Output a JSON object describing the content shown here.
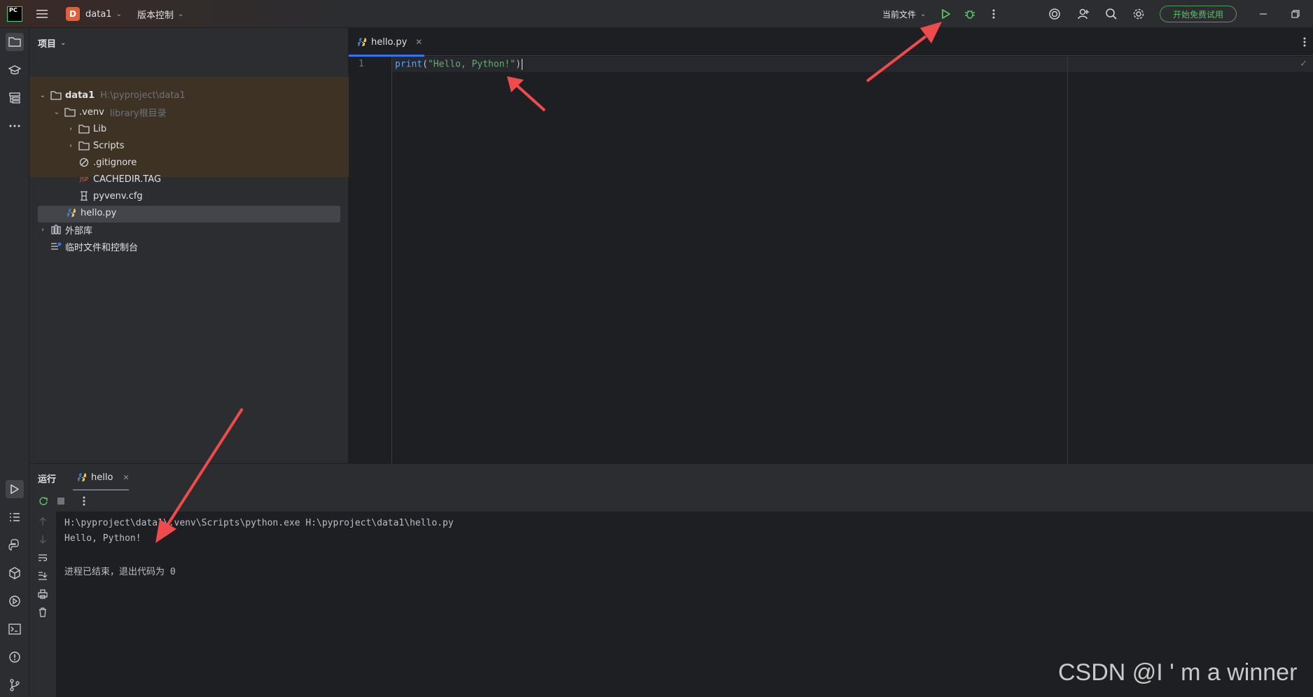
{
  "titlebar": {
    "logo_text": "PC",
    "project_badge": "D",
    "project_name": "data1",
    "vcs_label": "版本控制",
    "run_config": "当前文件",
    "trial_button": "开始免费试用"
  },
  "project_panel": {
    "header": "项目",
    "tree": [
      {
        "name": "data1",
        "hint": "H:\\pyproject\\data1"
      },
      {
        "name": ".venv",
        "hint": "library根目录"
      },
      {
        "name": "Lib"
      },
      {
        "name": "Scripts"
      },
      {
        "name": ".gitignore"
      },
      {
        "name": "CACHEDIR.TAG"
      },
      {
        "name": "pyvenv.cfg"
      },
      {
        "name": "hello.py"
      },
      {
        "name": "外部库"
      },
      {
        "name": "临时文件和控制台"
      }
    ]
  },
  "editor": {
    "tab_label": "hello.py",
    "line_number": "1",
    "code": {
      "fn": "print",
      "open": "(",
      "str": "\"Hello, Python!\"",
      "close": ")"
    }
  },
  "run_panel": {
    "title": "运行",
    "tab_label": "hello",
    "console_lines": [
      "H:\\pyproject\\data1\\.venv\\Scripts\\python.exe H:\\pyproject\\data1\\hello.py",
      "Hello, Python!",
      "",
      "进程已结束，退出代码为 0"
    ]
  },
  "watermark": "CSDN @I ' m a winner",
  "colors": {
    "accent": "#3574f0",
    "run_green": "#57c262",
    "annotation_red": "#f04b4b"
  }
}
